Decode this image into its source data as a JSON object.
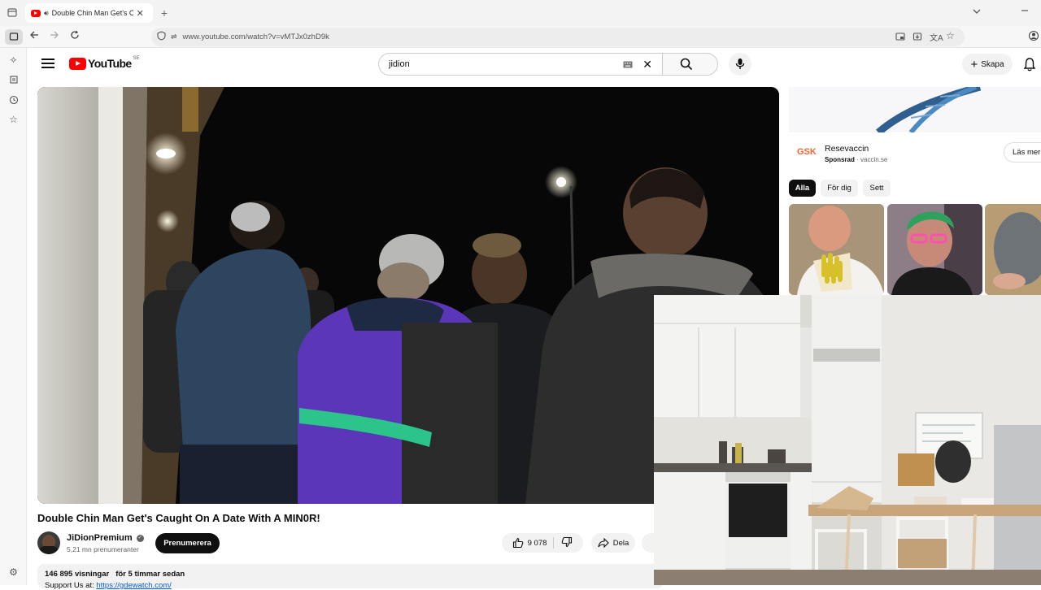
{
  "browser": {
    "tab_title": "Double Chin Man Get's Caught On A Date With A MIN0R!",
    "tab_title_short": "Double Chin Man Get's Ca",
    "url": "www.youtube.com/watch?v=vMTJx0zhD9k",
    "new_tab_icon": "plus-icon",
    "accent_color": "#e0e0e0"
  },
  "youtube": {
    "logo_text": "YouTube",
    "country_code": "SE",
    "search_value": "jidion",
    "create_label": "Skapa",
    "brand_red": "#ff0000"
  },
  "video": {
    "title": "Double Chin Man Get's Caught On A Date With A MIN0R!",
    "channel_name": "JiDionPremium",
    "subscribers": "5,21 mn prenumeranter",
    "subscribe_label": "Prenumerera",
    "likes": "9 078",
    "share_label": "Dela",
    "views": "146 895 visningar",
    "posted": "för 5 timmar sedan",
    "desc_line": "Support Us at: ",
    "desc_link": "https://gdewatch.com/"
  },
  "sidebar": {
    "ad": {
      "title": "Resevaccin",
      "sponsored_label": "Sponsrad",
      "domain": "vaccin.se",
      "brand": "GSK",
      "cta": "Läs mer"
    },
    "chips": [
      "Alla",
      "För dig",
      "Sett"
    ]
  }
}
